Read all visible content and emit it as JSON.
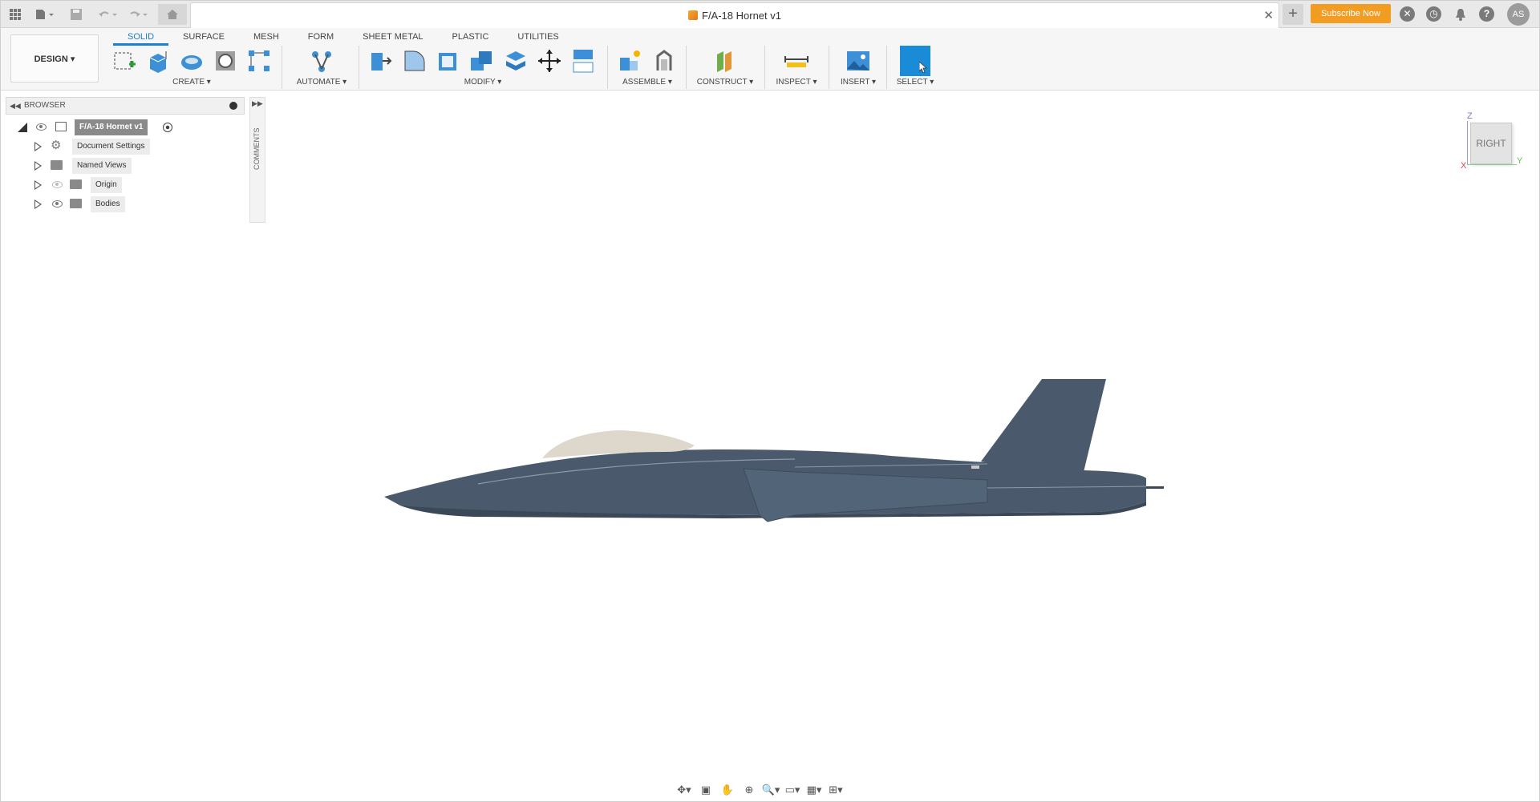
{
  "titlebar": {
    "document_title": "F/A-18 Hornet v1",
    "subscribe_label": "Subscribe Now",
    "avatar_initials": "AS",
    "icons": [
      "apps-grid-icon",
      "file-menu-icon",
      "save-icon",
      "undo-icon",
      "redo-icon",
      "home-icon",
      "close-tab-icon",
      "new-tab-icon",
      "extensions-icon",
      "job-status-icon",
      "notifications-icon",
      "help-icon"
    ]
  },
  "toolbar": {
    "workspace_label": "DESIGN",
    "tabs": [
      {
        "label": "SOLID",
        "active": true
      },
      {
        "label": "SURFACE",
        "active": false
      },
      {
        "label": "MESH",
        "active": false
      },
      {
        "label": "FORM",
        "active": false
      },
      {
        "label": "SHEET METAL",
        "active": false
      },
      {
        "label": "PLASTIC",
        "active": false
      },
      {
        "label": "UTILITIES",
        "active": false
      }
    ],
    "groups": {
      "create": "CREATE",
      "automate": "AUTOMATE",
      "modify": "MODIFY",
      "assemble": "ASSEMBLE",
      "construct": "CONSTRUCT",
      "inspect": "INSPECT",
      "insert": "INSERT",
      "select": "SELECT"
    }
  },
  "browser": {
    "title": "BROWSER",
    "root": "F/A-18 Hornet v1",
    "items": [
      {
        "label": "Document Settings"
      },
      {
        "label": "Named Views"
      },
      {
        "label": "Origin"
      },
      {
        "label": "Bodies"
      }
    ]
  },
  "comments_label": "COMMENTS",
  "viewcube": {
    "face": "RIGHT",
    "axis_z": "Z",
    "axis_y": "Y",
    "axis_x": "X"
  },
  "colors": {
    "accent": "#1a7fd1",
    "subscribe": "#f39c22",
    "aircraft_body": "#4a5a6c",
    "canopy": "#ded8cc"
  }
}
